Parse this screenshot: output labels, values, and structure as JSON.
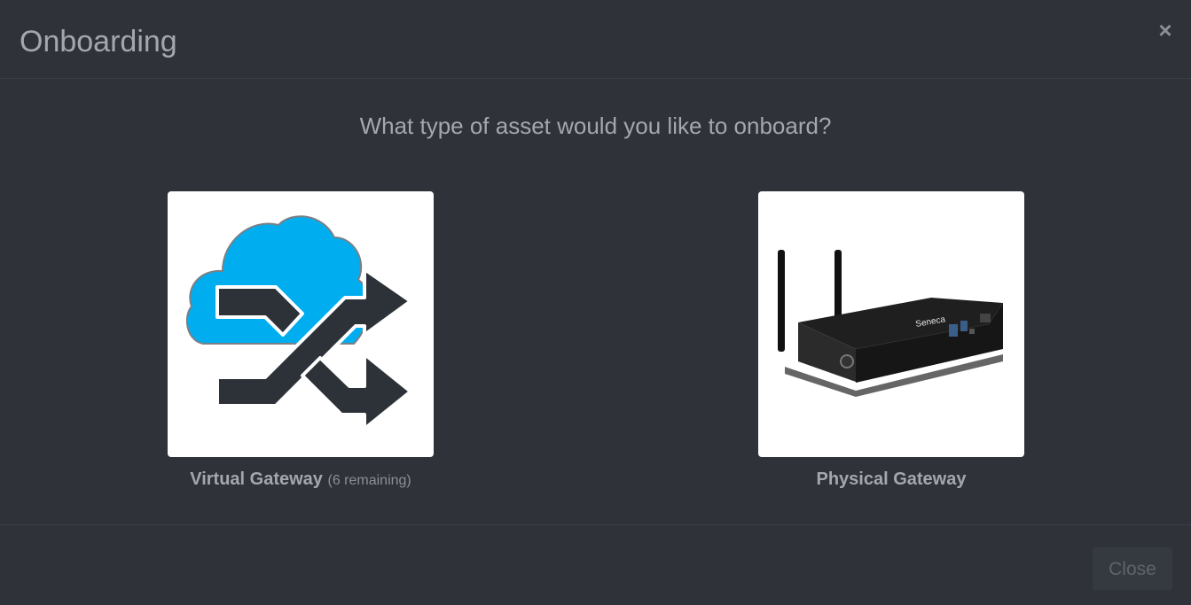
{
  "modal": {
    "title": "Onboarding",
    "close_icon": "close-icon",
    "question": "What type of asset would you like to onboard?"
  },
  "options": [
    {
      "label": "Virtual Gateway",
      "remaining": "(6 remaining)",
      "icon": "virtual-gateway-icon"
    },
    {
      "label": "Physical Gateway",
      "icon": "physical-gateway-image",
      "device_brand": "Seneca"
    }
  ],
  "footer": {
    "close_label": "Close"
  },
  "colors": {
    "background": "#2f3239",
    "text": "#a3a8ae",
    "cloud": "#00aeef",
    "arrow": "#2d3138"
  }
}
